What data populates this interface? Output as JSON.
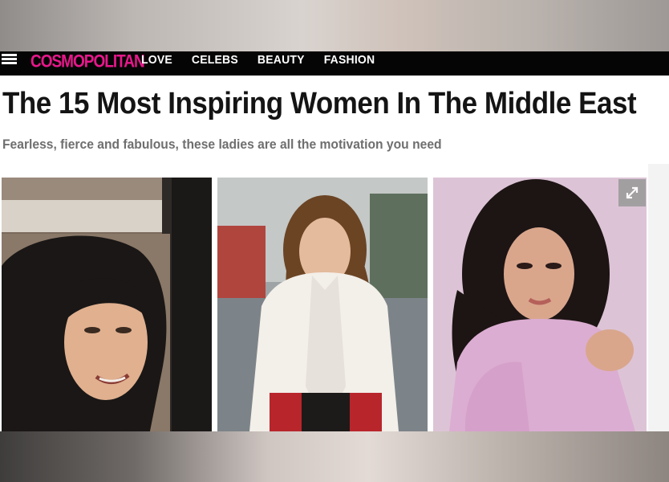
{
  "nav": {
    "logo": "COSMOPOLITAN",
    "links": [
      "LOVE",
      "CELEBS",
      "BEAUTY",
      "FASHION"
    ]
  },
  "article": {
    "title": "The 15 Most Inspiring Women In The Middle East",
    "subtitle": "Fearless, fierce and fabulous, these ladies are all the motivation you need"
  },
  "icons": {
    "menu": "hamburger-menu-icon",
    "expand": "expand-arrows-icon"
  },
  "colors": {
    "brand": "#e8178b",
    "nav_bg": "#050505",
    "headline": "#141414",
    "subtitle": "#6f6f6f"
  }
}
